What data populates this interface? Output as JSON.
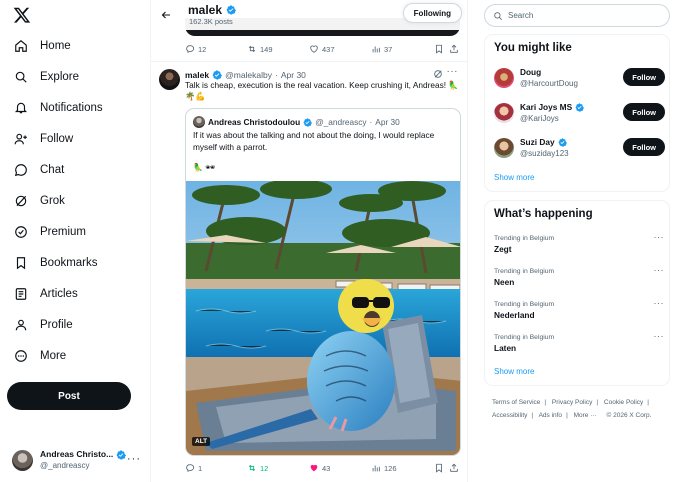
{
  "nav": {
    "logo": "x-logo-icon",
    "items": [
      {
        "label": "Home",
        "icon": "home-icon"
      },
      {
        "label": "Explore",
        "icon": "search-icon"
      },
      {
        "label": "Notifications",
        "icon": "bell-icon"
      },
      {
        "label": "Follow",
        "icon": "person-add-icon"
      },
      {
        "label": "Chat",
        "icon": "chat-bubble-icon"
      },
      {
        "label": "Grok",
        "icon": "grok-icon"
      },
      {
        "label": "Premium",
        "icon": "premium-badge-icon"
      },
      {
        "label": "Bookmarks",
        "icon": "bookmark-icon"
      },
      {
        "label": "Articles",
        "icon": "article-icon"
      },
      {
        "label": "Profile",
        "icon": "person-icon"
      },
      {
        "label": "More",
        "icon": "more-circle-icon"
      }
    ],
    "post_label": "Post",
    "account": {
      "name": "Andreas Christo...",
      "handle": "@_andreascy",
      "more": "···"
    }
  },
  "topbar": {
    "name": "malek",
    "posts": "162.3K posts",
    "following_label": "Following"
  },
  "prev_actions": {
    "replies": "12",
    "reposts": "149",
    "likes": "437",
    "views": "37"
  },
  "tweet": {
    "name": "malek",
    "handle": "@malekalby",
    "sep": "·",
    "date": "Apr 30",
    "text": "Talk is cheap, execution is the real vacation. Keep crushing it, Andreas! 🦜🌴💪",
    "actions": {
      "replies": "1",
      "reposts": "12",
      "likes": "43",
      "views": "126"
    }
  },
  "quote": {
    "name": "Andreas Christodoulou",
    "handle": "@_andreascy",
    "sep": "·",
    "date": "Apr 30",
    "text": "If it was about the talking and not about the doing, I would replace myself with a parrot.",
    "emoji": "🦜 🕶",
    "image_alt": "ALT"
  },
  "search": {
    "placeholder": "Search"
  },
  "who_to_follow": {
    "title": "You might like",
    "users": [
      {
        "name": "Doug",
        "handle": "@HarcourtDoug",
        "verified": false,
        "follow_label": "Follow"
      },
      {
        "name": "Kari Joys MS",
        "handle": "@KariJoys",
        "verified": true,
        "follow_label": "Follow"
      },
      {
        "name": "Suzi Day",
        "handle": "@suziday123",
        "verified": true,
        "follow_label": "Follow"
      }
    ],
    "show_more": "Show more"
  },
  "trending": {
    "title": "What’s happening",
    "items": [
      {
        "context": "Trending in Belgium",
        "topic": "Zegt"
      },
      {
        "context": "Trending in Belgium",
        "topic": "Neen"
      },
      {
        "context": "Trending in Belgium",
        "topic": "Nederland"
      },
      {
        "context": "Trending in Belgium",
        "topic": "Laten"
      }
    ],
    "show_more": "Show more"
  },
  "footer": {
    "links": [
      "Terms of Service",
      "Privacy Policy",
      "Cookie Policy",
      "Accessibility",
      "Ads info",
      "More ···"
    ],
    "copyright": "© 2026 X Corp."
  },
  "colors": {
    "accent": "#1d9bf0",
    "text": "#0f1419",
    "muted": "#536471",
    "repost": "#00ba7c",
    "like": "#f91880"
  }
}
